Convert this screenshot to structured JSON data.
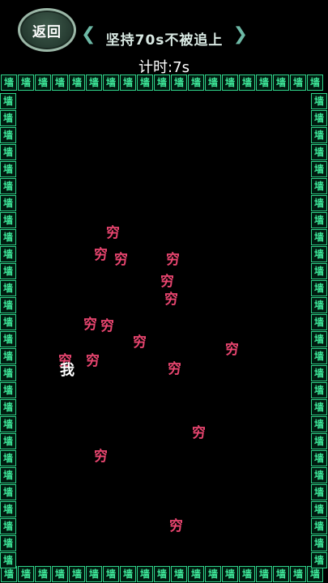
{
  "header": {
    "back_label": "返回",
    "title": "坚持70s不被追上",
    "chevron_left": "❮",
    "chevron_right": "❯",
    "timer": "计时:7s"
  },
  "wall_char": "墙",
  "player_char": "我",
  "enemy_char": "穷",
  "colors": {
    "wall": "#3ee89a",
    "enemy": "#e8456f",
    "player": "#ffffff"
  }
}
